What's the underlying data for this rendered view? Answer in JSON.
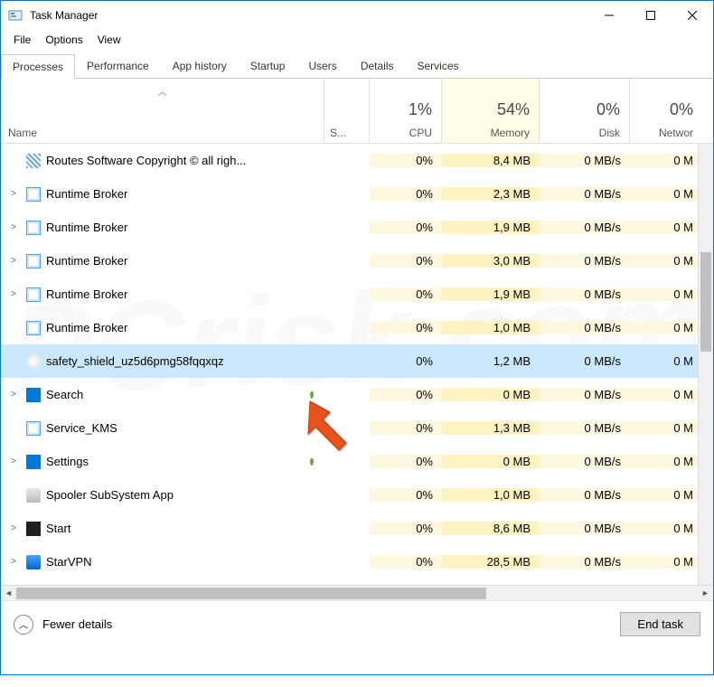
{
  "window": {
    "title": "Task Manager"
  },
  "menu": {
    "file": "File",
    "options": "Options",
    "view": "View"
  },
  "tabs": [
    "Processes",
    "Performance",
    "App history",
    "Startup",
    "Users",
    "Details",
    "Services"
  ],
  "active_tab": 0,
  "columns": {
    "name": "Name",
    "status": "S...",
    "cpu": {
      "pct": "1%",
      "label": "CPU"
    },
    "memory": {
      "pct": "54%",
      "label": "Memory"
    },
    "disk": {
      "pct": "0%",
      "label": "Disk"
    },
    "network": {
      "pct": "0%",
      "label": "Networ"
    }
  },
  "processes": [
    {
      "expand": false,
      "icon": "ico-win",
      "name": "Routes Software Copyright © all righ...",
      "leaf": false,
      "cpu": "0%",
      "mem": "8,4 MB",
      "disk": "0 MB/s",
      "net": "0 M"
    },
    {
      "expand": true,
      "icon": "ico-app",
      "name": "Runtime Broker",
      "leaf": false,
      "cpu": "0%",
      "mem": "2,3 MB",
      "disk": "0 MB/s",
      "net": "0 M"
    },
    {
      "expand": true,
      "icon": "ico-app",
      "name": "Runtime Broker",
      "leaf": false,
      "cpu": "0%",
      "mem": "1,9 MB",
      "disk": "0 MB/s",
      "net": "0 M"
    },
    {
      "expand": true,
      "icon": "ico-app",
      "name": "Runtime Broker",
      "leaf": false,
      "cpu": "0%",
      "mem": "3,0 MB",
      "disk": "0 MB/s",
      "net": "0 M"
    },
    {
      "expand": true,
      "icon": "ico-app",
      "name": "Runtime Broker",
      "leaf": false,
      "cpu": "0%",
      "mem": "1,9 MB",
      "disk": "0 MB/s",
      "net": "0 M"
    },
    {
      "expand": false,
      "icon": "ico-app",
      "name": "Runtime Broker",
      "leaf": false,
      "cpu": "0%",
      "mem": "1,0 MB",
      "disk": "0 MB/s",
      "net": "0 M"
    },
    {
      "expand": false,
      "icon": "ico-shield",
      "name": "safety_shield_uz5d6pmg58fqqxqz",
      "leaf": false,
      "cpu": "0%",
      "mem": "1,2 MB",
      "disk": "0 MB/s",
      "net": "0 M",
      "selected": true
    },
    {
      "expand": true,
      "icon": "ico-search",
      "name": "Search",
      "leaf": true,
      "cpu": "0%",
      "mem": "0 MB",
      "disk": "0 MB/s",
      "net": "0 M"
    },
    {
      "expand": false,
      "icon": "ico-app",
      "name": "Service_KMS",
      "leaf": false,
      "cpu": "0%",
      "mem": "1,3 MB",
      "disk": "0 MB/s",
      "net": "0 M"
    },
    {
      "expand": true,
      "icon": "ico-gear",
      "name": "Settings",
      "leaf": true,
      "cpu": "0%",
      "mem": "0 MB",
      "disk": "0 MB/s",
      "net": "0 M"
    },
    {
      "expand": false,
      "icon": "ico-printer",
      "name": "Spooler SubSystem App",
      "leaf": false,
      "cpu": "0%",
      "mem": "1,0 MB",
      "disk": "0 MB/s",
      "net": "0 M"
    },
    {
      "expand": true,
      "icon": "ico-dark",
      "name": "Start",
      "leaf": false,
      "cpu": "0%",
      "mem": "8,6 MB",
      "disk": "0 MB/s",
      "net": "0 M"
    },
    {
      "expand": true,
      "icon": "ico-blue",
      "name": "StarVPN",
      "leaf": false,
      "cpu": "0%",
      "mem": "28,5 MB",
      "disk": "0 MB/s",
      "net": "0 M"
    }
  ],
  "footer": {
    "fewer": "Fewer details",
    "endtask": "End task"
  }
}
